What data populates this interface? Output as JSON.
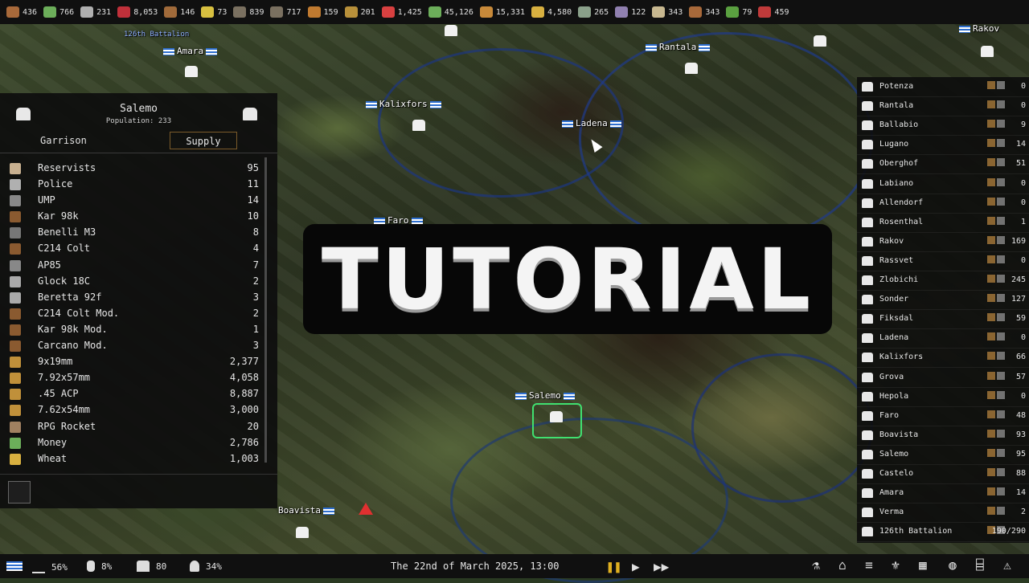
{
  "resources": [
    {
      "icon": "wood-icon",
      "value": "436",
      "color": "#a8693a"
    },
    {
      "icon": "money-icon",
      "value": "766",
      "color": "#6cae5a"
    },
    {
      "icon": "fuel-can-icon",
      "value": "231",
      "color": "#b0b0b0"
    },
    {
      "icon": "gas-canister-icon",
      "value": "8,053",
      "color": "#c0303a"
    },
    {
      "icon": "rifle-icon",
      "value": "146",
      "color": "#a06a3a"
    },
    {
      "icon": "rocket-icon",
      "value": "73",
      "color": "#d8c040"
    },
    {
      "icon": "mortar-icon",
      "value": "839",
      "color": "#7a7060"
    },
    {
      "icon": "cannon-icon",
      "value": "717",
      "color": "#7a7060"
    },
    {
      "icon": "ammo-icon",
      "value": "159",
      "color": "#c07a30"
    },
    {
      "icon": "shells-icon",
      "value": "201",
      "color": "#b8903a"
    },
    {
      "icon": "medkit-icon",
      "value": "1,425",
      "color": "#d84040"
    },
    {
      "icon": "cash-icon",
      "value": "45,126",
      "color": "#6cae5a"
    },
    {
      "icon": "bread-icon",
      "value": "15,331",
      "color": "#c88a3a"
    },
    {
      "icon": "wheat-icon",
      "value": "4,580",
      "color": "#d8b040"
    },
    {
      "icon": "metal-icon",
      "value": "265",
      "color": "#8aa08a"
    },
    {
      "icon": "steel-icon",
      "value": "122",
      "color": "#9080b0"
    },
    {
      "icon": "crate-icon",
      "value": "343",
      "color": "#c8b890"
    },
    {
      "icon": "plank-icon",
      "value": "343",
      "color": "#a8693a"
    },
    {
      "icon": "vegetable-icon",
      "value": "79",
      "color": "#5aa040"
    },
    {
      "icon": "meat-icon",
      "value": "459",
      "color": "#c03a3a"
    }
  ],
  "map_labels": {
    "battalion": "126th Battalion",
    "amara": "Amara",
    "rantala": "Rantala",
    "kalixfors": "Kalixfors",
    "ladena": "Ladena",
    "faro": "Faro",
    "salemo": "Salemo",
    "boavista": "Boavista",
    "rakov": "Rakov"
  },
  "left_panel": {
    "title": "Salemo",
    "population": "Population: 233",
    "tab_garrison": "Garrison",
    "tab_supply": "Supply",
    "items": [
      {
        "name": "Reservists",
        "value": "95",
        "icon": "soldier-icon"
      },
      {
        "name": "Police",
        "value": "11",
        "icon": "police-icon"
      },
      {
        "name": "UMP",
        "value": "14",
        "icon": "smg-icon"
      },
      {
        "name": "Kar 98k",
        "value": "10",
        "icon": "rifle-icon"
      },
      {
        "name": "Benelli M3",
        "value": "8",
        "icon": "shotgun-icon"
      },
      {
        "name": "C214 Colt",
        "value": "4",
        "icon": "rifle-icon"
      },
      {
        "name": "AP85",
        "value": "7",
        "icon": "smg-icon"
      },
      {
        "name": "Glock 18C",
        "value": "2",
        "icon": "pistol-icon"
      },
      {
        "name": "Beretta 92f",
        "value": "3",
        "icon": "pistol-icon"
      },
      {
        "name": "C214 Colt Mod.",
        "value": "2",
        "icon": "rifle-icon"
      },
      {
        "name": "Kar 98k Mod.",
        "value": "1",
        "icon": "rifle-icon"
      },
      {
        "name": "Carcano Mod.",
        "value": "3",
        "icon": "rifle-icon"
      },
      {
        "name": "9x19mm",
        "value": "2,377",
        "icon": "ammo-icon"
      },
      {
        "name": "7.92x57mm",
        "value": "4,058",
        "icon": "ammo-icon"
      },
      {
        "name": ".45 ACP",
        "value": "8,887",
        "icon": "ammo-icon"
      },
      {
        "name": "7.62x54mm",
        "value": "3,000",
        "icon": "ammo-icon"
      },
      {
        "name": "RPG Rocket",
        "value": "20",
        "icon": "rocket-icon"
      },
      {
        "name": "Money",
        "value": "2,786",
        "icon": "money-icon"
      },
      {
        "name": "Wheat",
        "value": "1,003",
        "icon": "wheat-icon"
      }
    ]
  },
  "tutorial_banner": "TUTORIAL",
  "right_panel": [
    {
      "name": "Potenza",
      "value": "0"
    },
    {
      "name": "Rantala",
      "value": "0"
    },
    {
      "name": "Ballabio",
      "value": "9"
    },
    {
      "name": "Lugano",
      "value": "14"
    },
    {
      "name": "Oberghof",
      "value": "51"
    },
    {
      "name": "Labiano",
      "value": "0"
    },
    {
      "name": "Allendorf",
      "value": "0"
    },
    {
      "name": "Rosenthal",
      "value": "1"
    },
    {
      "name": "Rakov",
      "value": "169"
    },
    {
      "name": "Rassvet",
      "value": "0"
    },
    {
      "name": "Zlobichi",
      "value": "245"
    },
    {
      "name": "Sonder",
      "value": "127"
    },
    {
      "name": "Fiksdal",
      "value": "59"
    },
    {
      "name": "Ladena",
      "value": "0"
    },
    {
      "name": "Kalixfors",
      "value": "66"
    },
    {
      "name": "Grova",
      "value": "57"
    },
    {
      "name": "Hepola",
      "value": "0"
    },
    {
      "name": "Faro",
      "value": "48"
    },
    {
      "name": "Boavista",
      "value": "93"
    },
    {
      "name": "Salemo",
      "value": "95"
    },
    {
      "name": "Castelo",
      "value": "88"
    },
    {
      "name": "Amara",
      "value": "14"
    },
    {
      "name": "Verma",
      "value": "2"
    },
    {
      "name": "126th Battalion",
      "value": "190/290"
    }
  ],
  "bottom_bar": {
    "approval": "56%",
    "unrest": "8%",
    "buildings": "80",
    "police": "34%",
    "datetime": "The 22nd of March 2025, 13:00"
  }
}
